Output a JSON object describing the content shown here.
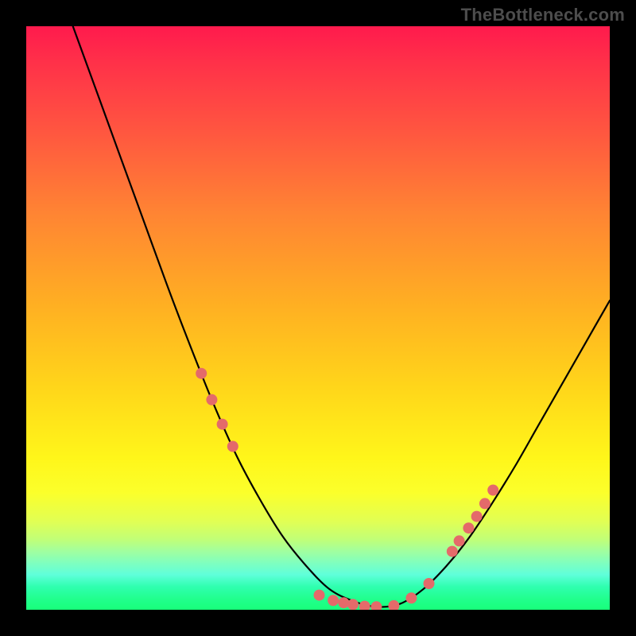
{
  "watermark": "TheBottleneck.com",
  "chart_data": {
    "type": "line",
    "title": "",
    "xlabel": "",
    "ylabel": "",
    "xlim": [
      0,
      1
    ],
    "ylim": [
      0,
      1
    ],
    "grid": false,
    "legend": false,
    "gradient_stops": [
      {
        "pos": 0.0,
        "color": "#ff1a4d"
      },
      {
        "pos": 0.06,
        "color": "#ff3049"
      },
      {
        "pos": 0.18,
        "color": "#ff5640"
      },
      {
        "pos": 0.32,
        "color": "#ff8433"
      },
      {
        "pos": 0.48,
        "color": "#ffb022"
      },
      {
        "pos": 0.62,
        "color": "#ffd61a"
      },
      {
        "pos": 0.74,
        "color": "#fff61a"
      },
      {
        "pos": 0.8,
        "color": "#fbff2b"
      },
      {
        "pos": 0.85,
        "color": "#e0ff55"
      },
      {
        "pos": 0.88,
        "color": "#c0ff78"
      },
      {
        "pos": 0.9,
        "color": "#a0ffa0"
      },
      {
        "pos": 0.92,
        "color": "#7fffbf"
      },
      {
        "pos": 0.94,
        "color": "#5fffda"
      },
      {
        "pos": 0.96,
        "color": "#30ffb0"
      },
      {
        "pos": 0.98,
        "color": "#22ff8f"
      },
      {
        "pos": 1.0,
        "color": "#18ff7a"
      }
    ],
    "series": [
      {
        "name": "curve",
        "color": "#000000",
        "x": [
          0.08,
          0.12,
          0.16,
          0.2,
          0.24,
          0.28,
          0.32,
          0.36,
          0.4,
          0.44,
          0.48,
          0.52,
          0.56,
          0.6,
          0.64,
          0.68,
          0.72,
          0.76,
          0.8,
          0.84,
          0.88,
          0.92,
          0.96,
          1.0
        ],
        "y": [
          1.0,
          0.89,
          0.78,
          0.67,
          0.56,
          0.455,
          0.355,
          0.265,
          0.19,
          0.125,
          0.075,
          0.035,
          0.015,
          0.005,
          0.01,
          0.035,
          0.075,
          0.125,
          0.185,
          0.25,
          0.32,
          0.39,
          0.46,
          0.53
        ]
      }
    ],
    "markers": {
      "name": "highlight-dots",
      "color": "#e46a6a",
      "radius_px": 7,
      "x": [
        0.3,
        0.318,
        0.336,
        0.354,
        0.502,
        0.526,
        0.544,
        0.56,
        0.58,
        0.6,
        0.63,
        0.66,
        0.69,
        0.73,
        0.742,
        0.758,
        0.772,
        0.786,
        0.8
      ],
      "y": [
        0.405,
        0.36,
        0.318,
        0.28,
        0.025,
        0.016,
        0.012,
        0.009,
        0.006,
        0.005,
        0.007,
        0.02,
        0.045,
        0.1,
        0.118,
        0.14,
        0.16,
        0.182,
        0.205
      ]
    }
  }
}
